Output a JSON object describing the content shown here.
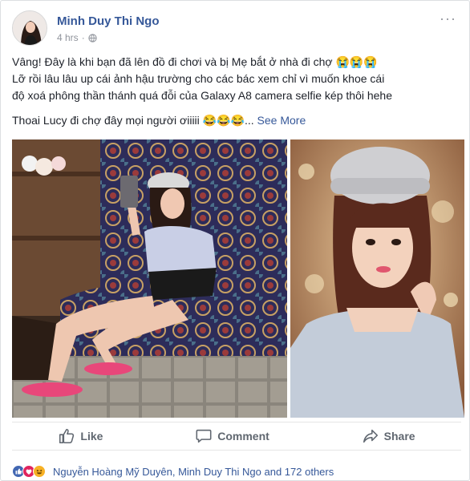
{
  "post": {
    "author": "Minh Duy Thi Ngo",
    "time": "4 hrs",
    "text_lines": [
      "Vâng! Đây là khi bạn đã lên đồ đi chơi và bị Mẹ bắt ở nhà đi chợ 😭😭😭",
      "Lỡ rồi lâu lâu up cái ảnh hậu trường cho các bác xem chỉ vì muốn khoe cái",
      "độ xoá phông thần thánh quá đỗi của Galaxy A8 camera selfie kép thôi hehe",
      "Thoai Lucy đi chợ đây mọi người ơiiiii 😂😂😂..."
    ],
    "see_more": "See More"
  },
  "actions": {
    "like": "Like",
    "comment": "Comment",
    "share": "Share"
  },
  "reactions": {
    "summary": "Nguyễn Hoàng Mỹ Duyên, Minh Duy Thi Ngo and 172 others"
  },
  "colors": {
    "link": "#365899",
    "secondary": "#90949c",
    "action": "#606770",
    "like": "#4267b2",
    "love": "#e0245e",
    "haha": "#f7b125"
  },
  "icons": [
    "more-options-icon",
    "globe-icon",
    "like-icon",
    "comment-icon",
    "share-icon",
    "like-reaction-icon",
    "love-reaction-icon",
    "haha-reaction-icon"
  ]
}
